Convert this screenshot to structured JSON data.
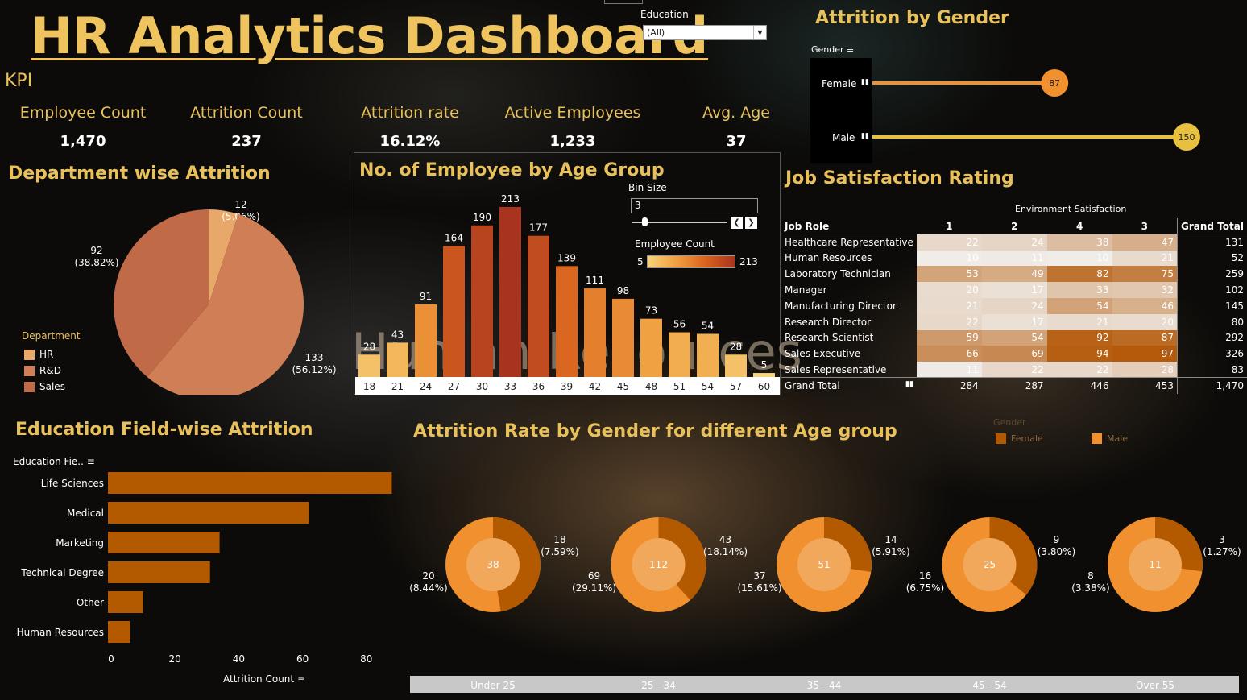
{
  "header": {
    "title": "HR Analytics Dashboard",
    "kpi_label": "KPI"
  },
  "kpis": [
    {
      "label": "Employee Count",
      "value": "1,470"
    },
    {
      "label": "Attrition Count",
      "value": "237"
    },
    {
      "label": "Attrition rate",
      "value": "16.12%"
    },
    {
      "label": "Active Employees",
      "value": "1,233"
    },
    {
      "label": "Avg. Age",
      "value": "37"
    }
  ],
  "filter": {
    "label": "Education",
    "value": "(All)"
  },
  "gender": {
    "title": "Attrition by Gender",
    "field_label": "Gender",
    "rows": [
      {
        "label": "Female",
        "value": 87
      },
      {
        "label": "Male",
        "value": 150
      }
    ]
  },
  "dept": {
    "title": "Department wise Attrition",
    "legend_title": "Department",
    "legend": [
      "HR",
      "R&D",
      "Sales"
    ]
  },
  "age_group": {
    "title": "No. of Employee by Age Group",
    "bin_label": "Bin Size",
    "bin_value": "3",
    "count_label": "Employee Count",
    "count_min": "5",
    "count_max": "213",
    "watermark": "Human Resources"
  },
  "job": {
    "title": "Job Satisfaction Rating",
    "env_label": "Environment Satisfaction",
    "role_header": "Job Role",
    "cols": [
      "1",
      "2",
      "4",
      "3"
    ],
    "total_header": "Grand Total",
    "total_label": "Grand Total",
    "rows": [
      {
        "role": "Healthcare Representative",
        "vals": [
          22,
          24,
          38,
          47
        ],
        "total": 131
      },
      {
        "role": "Human Resources",
        "vals": [
          10,
          11,
          10,
          21
        ],
        "total": 52
      },
      {
        "role": "Laboratory Technician",
        "vals": [
          53,
          49,
          82,
          75
        ],
        "total": 259
      },
      {
        "role": "Manager",
        "vals": [
          20,
          17,
          33,
          32
        ],
        "total": 102
      },
      {
        "role": "Manufacturing Director",
        "vals": [
          21,
          24,
          54,
          46
        ],
        "total": 145
      },
      {
        "role": "Research Director",
        "vals": [
          22,
          17,
          21,
          20
        ],
        "total": 80
      },
      {
        "role": "Research Scientist",
        "vals": [
          59,
          54,
          92,
          87
        ],
        "total": 292
      },
      {
        "role": "Sales Executive",
        "vals": [
          66,
          69,
          94,
          97
        ],
        "total": 326
      },
      {
        "role": "Sales Representative",
        "vals": [
          11,
          22,
          22,
          28
        ],
        "total": 83
      }
    ],
    "totals": [
      284,
      287,
      446,
      453
    ],
    "grand_total": "1,470"
  },
  "edu": {
    "title": "Education Field-wise Attrition",
    "field_label": "Education Fie..",
    "axis_label": "Attrition Count"
  },
  "gender_age": {
    "title": "Attrition Rate by Gender for different Age group",
    "legend_title": "Gender",
    "legend": [
      "Female",
      "Male"
    ]
  },
  "colors": {
    "gold": "#e8c05c",
    "female": "#b35a00",
    "male": "#f0902e",
    "dark_orange": "#c0531f"
  },
  "chart_data": [
    {
      "type": "bar",
      "orientation": "horizontal",
      "title": "Attrition by Gender",
      "categories": [
        "Female",
        "Male"
      ],
      "values": [
        87,
        150
      ]
    },
    {
      "type": "pie",
      "title": "Department wise Attrition",
      "categories": [
        "HR",
        "R&D",
        "Sales"
      ],
      "values": [
        12,
        133,
        92
      ],
      "labels": [
        "12\n(5.06%)",
        "133\n(56.12%)",
        "92\n(38.82%)"
      ],
      "colors": [
        "#e8a86a",
        "#cf7e55",
        "#c06a48"
      ]
    },
    {
      "type": "bar",
      "title": "No. of Employee by Age Group",
      "categories": [
        "18",
        "21",
        "24",
        "27",
        "30",
        "33",
        "36",
        "39",
        "42",
        "45",
        "48",
        "51",
        "54",
        "57",
        "60"
      ],
      "values": [
        28,
        43,
        91,
        164,
        190,
        213,
        177,
        139,
        111,
        98,
        73,
        56,
        54,
        28,
        5
      ]
    },
    {
      "type": "table",
      "title": "Job Satisfaction Rating"
    },
    {
      "type": "bar",
      "orientation": "horizontal",
      "title": "Education Field-wise Attrition",
      "categories": [
        "Life Sciences",
        "Medical",
        "Marketing",
        "Technical Degree",
        "Other",
        "Human Resources"
      ],
      "values": [
        89,
        63,
        35,
        32,
        11,
        7
      ],
      "xlim": [
        0,
        90
      ],
      "xticks": [
        0,
        20,
        40,
        60,
        80
      ],
      "xlabel": "Attrition Count"
    },
    {
      "type": "pie",
      "title": "Attrition Rate by Gender for different Age group",
      "groups": [
        {
          "label": "Under 25",
          "total": 38,
          "female": 18,
          "female_pct": "7.59%",
          "male": 20,
          "male_pct": "8.44%"
        },
        {
          "label": "25 - 34",
          "total": 112,
          "female": 43,
          "female_pct": "18.14%",
          "male": 69,
          "male_pct": "29.11%"
        },
        {
          "label": "35 - 44",
          "total": 51,
          "female": 14,
          "female_pct": "5.91%",
          "male": 37,
          "male_pct": "15.61%"
        },
        {
          "label": "45 - 54",
          "total": 25,
          "female": 9,
          "female_pct": "3.80%",
          "male": 16,
          "male_pct": "6.75%"
        },
        {
          "label": "Over 55",
          "total": 11,
          "female": 3,
          "female_pct": "1.27%",
          "male": 8,
          "male_pct": "3.38%"
        }
      ]
    }
  ]
}
